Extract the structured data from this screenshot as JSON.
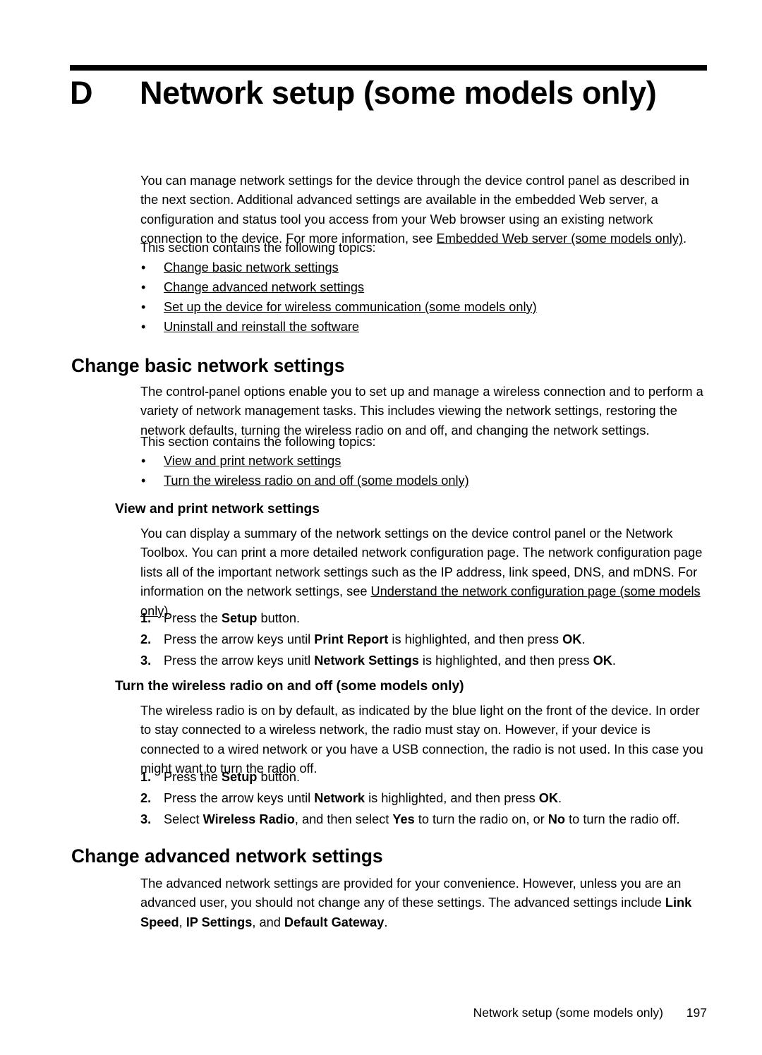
{
  "document": {
    "chapter_letter": "D",
    "chapter_title": "Network setup (some models only)"
  },
  "intro": {
    "paragraph_1_part_1": "You can manage network settings for the device through the device control panel as described in the next section. Additional advanced settings are available in the embedded Web server, a configuration and status tool you access from your Web browser using an existing network connection to the device. For more information, see ",
    "paragraph_1_link": "Embedded Web server (some models only)",
    "paragraph_1_part_2": ".",
    "topics_lead": "This section contains the following topics:",
    "topics": [
      "Change basic network settings",
      "Change advanced network settings",
      "Set up the device for wireless communication (some models only)",
      "Uninstall and reinstall the software"
    ],
    "bullet_glyph": "•"
  },
  "section_basic": {
    "heading": "Change basic network settings",
    "paragraph": "The control-panel options enable you to set up and manage a wireless connection and to perform a variety of network management tasks. This includes viewing the network settings, restoring the network defaults, turning the wireless radio on and off, and changing the network settings.",
    "topics_lead": "This section contains the following topics:",
    "topics": [
      "View and print network settings",
      "Turn the wireless radio on and off (some models only)"
    ]
  },
  "subsection_view_print": {
    "heading": "View and print network settings",
    "paragraph_part_1": "You can display a summary of the network settings on the device control panel or the Network Toolbox. You can print a more detailed network configuration page. The network configuration page lists all of the important network settings such as the IP address, link speed, DNS, and mDNS. For information on the network settings, see ",
    "paragraph_link": "Understand the network configuration page (some models only)",
    "paragraph_part_2": ".",
    "steps": [
      {
        "number": "1.",
        "segments": [
          {
            "text": "Press the ",
            "bold": false
          },
          {
            "text": "Setup",
            "bold": true
          },
          {
            "text": " button.",
            "bold": false
          }
        ]
      },
      {
        "number": "2.",
        "segments": [
          {
            "text": "Press the arrow keys until ",
            "bold": false
          },
          {
            "text": "Print Report",
            "bold": true
          },
          {
            "text": " is highlighted, and then press ",
            "bold": false
          },
          {
            "text": "OK",
            "bold": true
          },
          {
            "text": ".",
            "bold": false
          }
        ]
      },
      {
        "number": "3.",
        "segments": [
          {
            "text": "Press the arrow keys unitl ",
            "bold": false
          },
          {
            "text": "Network Settings",
            "bold": true
          },
          {
            "text": " is highlighted, and then press ",
            "bold": false
          },
          {
            "text": "OK",
            "bold": true
          },
          {
            "text": ".",
            "bold": false
          }
        ]
      }
    ]
  },
  "subsection_wireless_radio": {
    "heading": "Turn the wireless radio on and off (some models only)",
    "paragraph": "The wireless radio is on by default, as indicated by the blue light on the front of the device. In order to stay connected to a wireless network, the radio must stay on. However, if your device is connected to a wired network or you have a USB connection, the radio is not used. In this case you might want to turn the radio off.",
    "steps": [
      {
        "number": "1.",
        "segments": [
          {
            "text": "Press the ",
            "bold": false
          },
          {
            "text": "Setup",
            "bold": true
          },
          {
            "text": " button.",
            "bold": false
          }
        ]
      },
      {
        "number": "2.",
        "segments": [
          {
            "text": "Press the arrow keys until ",
            "bold": false
          },
          {
            "text": "Network",
            "bold": true
          },
          {
            "text": " is highlighted, and then press ",
            "bold": false
          },
          {
            "text": "OK",
            "bold": true
          },
          {
            "text": ".",
            "bold": false
          }
        ]
      },
      {
        "number": "3.",
        "segments": [
          {
            "text": "Select ",
            "bold": false
          },
          {
            "text": "Wireless Radio",
            "bold": true
          },
          {
            "text": ", and then select ",
            "bold": false
          },
          {
            "text": "Yes",
            "bold": true
          },
          {
            "text": " to turn the radio on, or ",
            "bold": false
          },
          {
            "text": "No",
            "bold": true
          },
          {
            "text": " to turn the radio off.",
            "bold": false
          }
        ]
      }
    ]
  },
  "section_advanced": {
    "heading": "Change advanced network settings",
    "paragraph_segments": [
      {
        "text": "The advanced network settings are provided for your convenience. However, unless you are an advanced user, you should not change any of these settings. The advanced settings include ",
        "bold": false
      },
      {
        "text": "Link Speed",
        "bold": true
      },
      {
        "text": ", ",
        "bold": false
      },
      {
        "text": "IP Settings",
        "bold": true
      },
      {
        "text": ", and ",
        "bold": false
      },
      {
        "text": "Default Gateway",
        "bold": true
      },
      {
        "text": ".",
        "bold": false
      }
    ]
  },
  "footer": {
    "title": "Network setup (some models only)",
    "page_number": "197"
  }
}
